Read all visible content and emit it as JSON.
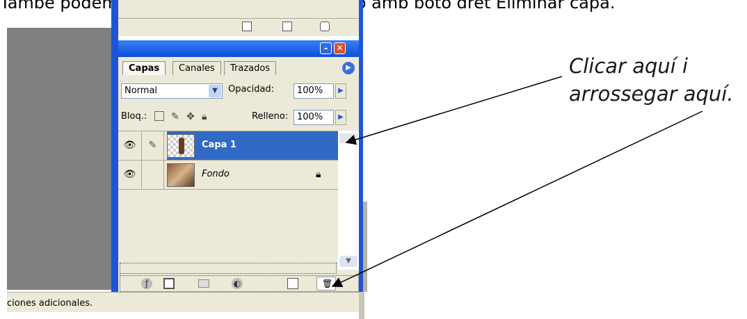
{
  "caption": {
    "text": "També podem anar al menú capes borrar, o  amb botó dret Eliminar capa."
  },
  "upper_panel": {
    "toolbar_icons": [
      "panel-icon",
      "camera-icon",
      "trash-icon"
    ]
  },
  "layers_panel": {
    "tabs": [
      {
        "label": "Capas",
        "active": true
      },
      {
        "label": "Canales",
        "active": false
      },
      {
        "label": "Trazados",
        "active": false
      }
    ],
    "blend_mode": "Normal",
    "opacity_label": "Opacidad:",
    "opacity_value": "100%",
    "lock_label": "Bloq.:",
    "fill_label": "Relleno:",
    "fill_value": "100%",
    "layers": [
      {
        "name": "Capa 1",
        "selected": true
      },
      {
        "name": "Fondo",
        "selected": false,
        "locked": true
      }
    ],
    "bottom_icons": [
      "link-icon",
      "mask-icon",
      "folder-icon",
      "adjustment-icon",
      "new-layer-icon",
      "trash-icon"
    ]
  },
  "status_bar": {
    "text": "ciones adicionales."
  },
  "annotation": {
    "line1": "Clicar aquí  i",
    "line2": "arrossegar aquí."
  },
  "colors": {
    "title_blue": "#0b4fd8",
    "selection_blue": "#316ac5",
    "panel_bg": "#ece9d8"
  }
}
